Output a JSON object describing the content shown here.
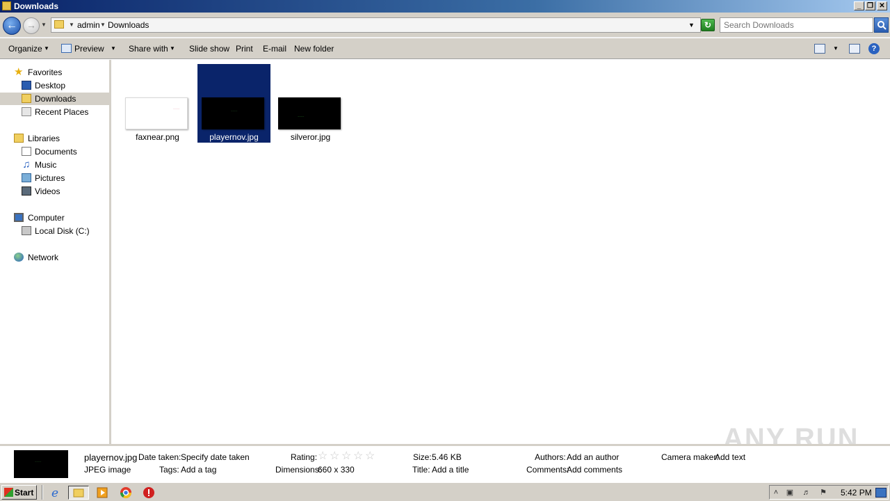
{
  "window": {
    "title": "Downloads",
    "controls": {
      "minimize": "_",
      "maximize": "❐",
      "close": "✕"
    }
  },
  "address_bar": {
    "breadcrumbs": [
      "admin",
      "Downloads"
    ],
    "search_placeholder": "Search Downloads"
  },
  "toolbar": {
    "organize": "Organize",
    "preview": "Preview",
    "share_with": "Share with",
    "slide_show": "Slide show",
    "print": "Print",
    "email": "E-mail",
    "new_folder": "New folder",
    "help": "?"
  },
  "nav": {
    "favorites": "Favorites",
    "desktop": "Desktop",
    "downloads": "Downloads",
    "recent_places": "Recent Places",
    "libraries": "Libraries",
    "documents": "Documents",
    "music": "Music",
    "pictures": "Pictures",
    "videos": "Videos",
    "computer": "Computer",
    "local_disk": "Local Disk (C:)",
    "network": "Network"
  },
  "files": [
    {
      "name": "faxnear.png",
      "thumb": "white",
      "selected": false
    },
    {
      "name": "playernov.jpg",
      "thumb": "black",
      "selected": true
    },
    {
      "name": "silveror.jpg",
      "thumb": "black",
      "selected": false
    }
  ],
  "details": {
    "filename": "playernov.jpg",
    "filetype": "JPEG image",
    "date_taken_label": "Date taken:",
    "date_taken_value": "Specify date taken",
    "tags_label": "Tags:",
    "tags_value": "Add a tag",
    "rating_label": "Rating:",
    "rating_stars": 0,
    "dimensions_label": "Dimensions:",
    "dimensions_value": "660 x 330",
    "size_label": "Size:",
    "size_value": "5.46 KB",
    "title_label": "Title:",
    "title_value": "Add a title",
    "authors_label": "Authors:",
    "authors_value": "Add an author",
    "comments_label": "Comments:",
    "comments_value": "Add comments",
    "camera_maker_label": "Camera maker:",
    "camera_maker_value": "Add text"
  },
  "watermark": "ANY RUN",
  "taskbar": {
    "start": "Start",
    "clock": "5:42 PM"
  },
  "colors": {
    "selection": "#0a246a",
    "chrome": "#d4d0c8"
  }
}
